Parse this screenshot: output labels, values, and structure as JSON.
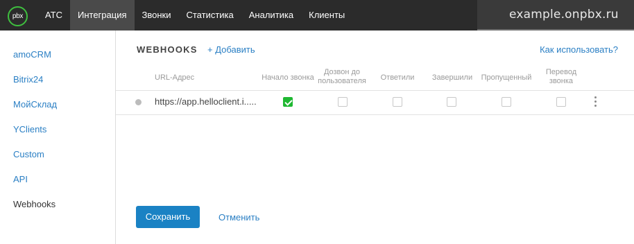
{
  "app": {
    "logo_text": "pbx",
    "domain": "example.onpbx.ru"
  },
  "nav": {
    "items": [
      {
        "label": "АТС",
        "active": false
      },
      {
        "label": "Интеграция",
        "active": true
      },
      {
        "label": "Звонки",
        "active": false
      },
      {
        "label": "Статистика",
        "active": false
      },
      {
        "label": "Аналитика",
        "active": false
      },
      {
        "label": "Клиенты",
        "active": false
      }
    ]
  },
  "sidebar": {
    "items": [
      {
        "label": "amoCRM",
        "active": false
      },
      {
        "label": "Bitrix24",
        "active": false
      },
      {
        "label": "МойСклад",
        "active": false
      },
      {
        "label": "YClients",
        "active": false
      },
      {
        "label": "Custom",
        "active": false
      },
      {
        "label": "API",
        "active": false
      },
      {
        "label": "Webhooks",
        "active": true
      }
    ]
  },
  "webhooks": {
    "title": "WEBHOOKS",
    "add_label": "+ Добавить",
    "howto_label": "Как использовать?",
    "columns": {
      "url": "URL-Адрес",
      "call_start": "Начало звонка",
      "dial_user": "Дозвон до пользователя",
      "answered": "Ответили",
      "finished": "Завершили",
      "missed": "Пропущенный",
      "transfer": "Перевод звонка"
    },
    "rows": [
      {
        "url": "https://app.helloclient.i.....",
        "status_color": "#bcbcbc",
        "call_start": true,
        "dial_user": false,
        "answered": false,
        "finished": false,
        "missed": false,
        "transfer": false
      }
    ],
    "save_label": "Сохранить",
    "cancel_label": "Отменить"
  },
  "colors": {
    "topbar": "#2b2b2b",
    "accent": "#1a82c4",
    "link": "#2a7fc4",
    "check": "#1fb832",
    "logo_ring": "#3fbf3f"
  },
  "icons": {
    "row_status": "status-dot-icon",
    "row_menu": "kebab-menu-icon",
    "checked": "checkmark-icon"
  }
}
